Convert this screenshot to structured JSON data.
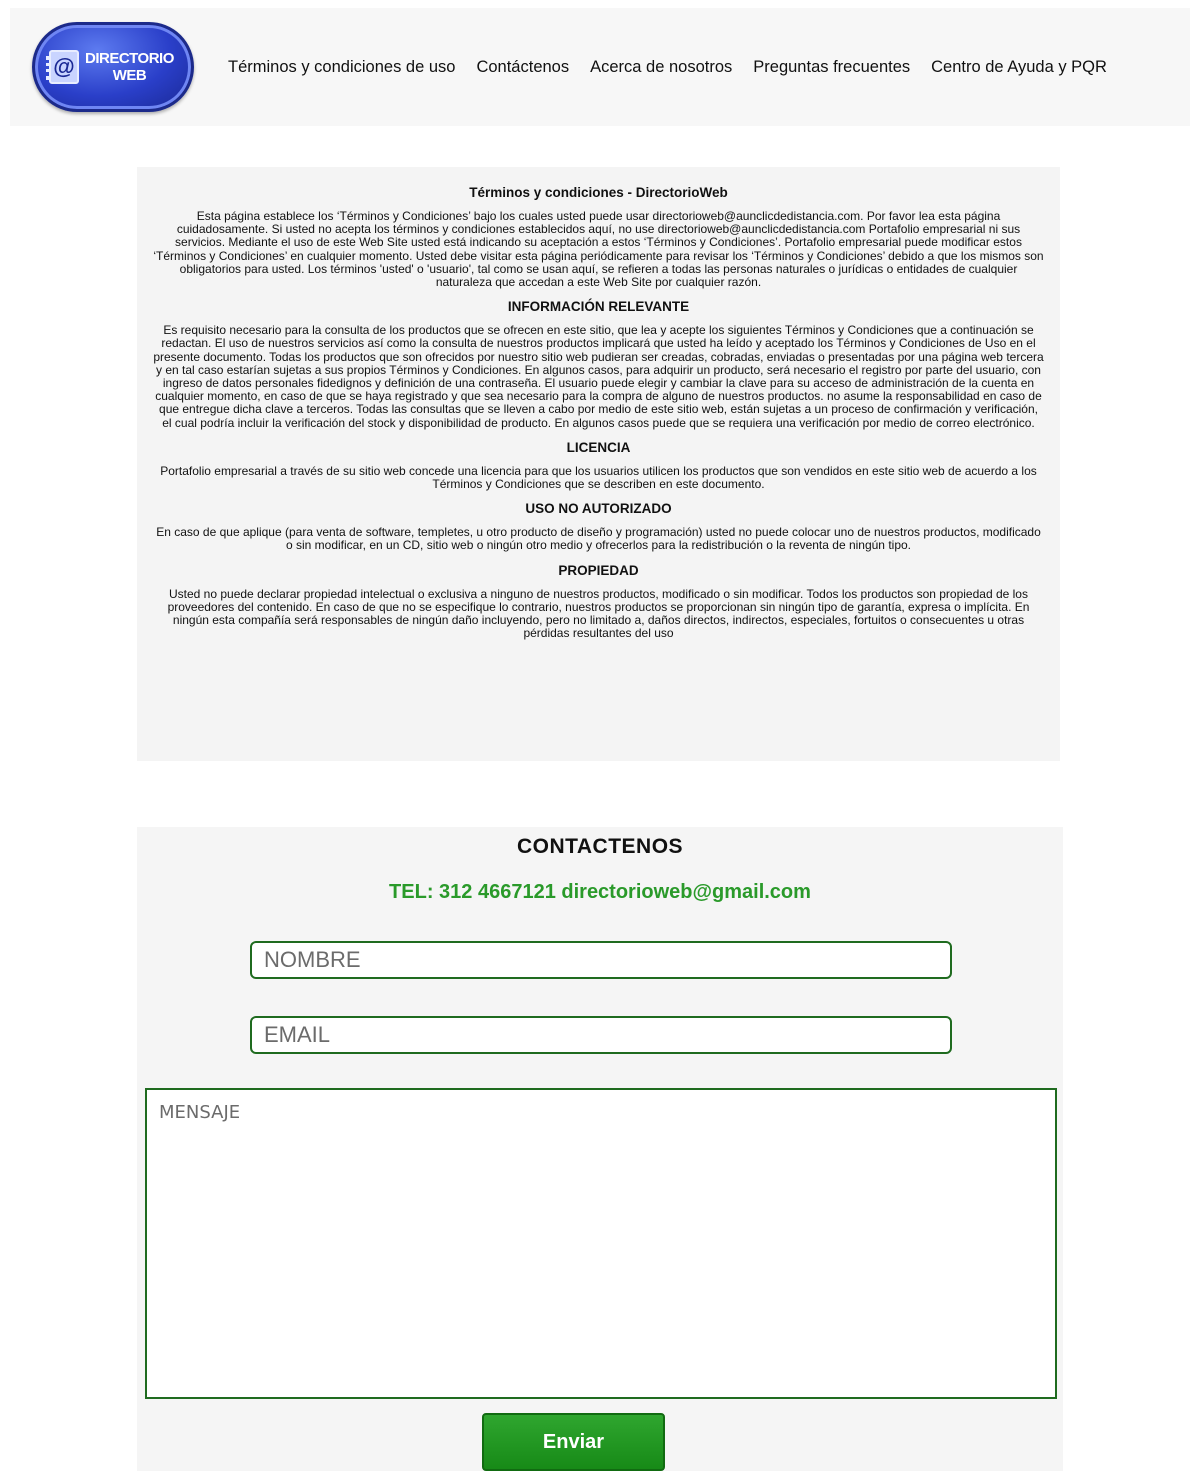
{
  "header": {
    "logo_line1": "DIRECTORIO",
    "logo_line2": "WEB",
    "logo_glyph": "@",
    "nav": [
      "Términos y condiciones de uso",
      "Contáctenos",
      "Acerca de nosotros",
      "Preguntas frecuentes",
      "Centro de Ayuda y PQR"
    ]
  },
  "terms": {
    "title": "Términos y condiciones - DirectorioWeb",
    "intro": "Esta página establece los ‘Términos y Condiciones’ bajo los cuales usted puede usar directorioweb@aunclicdedistancia.com. Por favor lea esta página cuidadosamente. Si usted no acepta los términos y condiciones establecidos aquí, no use directorioweb@aunclicdedistancia.com Portafolio empresarial ni sus servicios. Mediante el uso de este Web Site usted está indicando su aceptación a estos ‘Términos y Condiciones’. Portafolio empresarial puede modificar estos ‘Términos y Condiciones’ en cualquier momento. Usted debe visitar esta página periódicamente para revisar los ‘Términos y Condiciones’ debido a que los mismos son obligatorios para usted. Los términos 'usted' o 'usuario', tal como se usan aquí, se refieren a todas las personas naturales o jurídicas o entidades de cualquier naturaleza que accedan a este Web Site por cualquier razón.",
    "sections": [
      {
        "heading": "INFORMACIÓN RELEVANTE",
        "body": "Es requisito necesario para la consulta de los productos que se ofrecen en este sitio, que lea y acepte los siguientes Términos y Condiciones que a continuación se redactan. El uso de nuestros servicios así como la consulta de nuestros productos implicará que usted ha leído y aceptado los Términos y Condiciones de Uso en el presente documento. Todas los productos que son ofrecidos por nuestro sitio web pudieran ser creadas, cobradas, enviadas o presentadas por una página web tercera y en tal caso estarían sujetas a sus propios Términos y Condiciones. En algunos casos, para adquirir un producto, será necesario el registro por parte del usuario, con ingreso de datos personales fidedignos y definición de una contraseña. El usuario puede elegir y cambiar la clave para su acceso de administración de la cuenta en cualquier momento, en caso de que se haya registrado y que sea necesario para la compra de alguno de nuestros productos. no asume la responsabilidad en caso de que entregue dicha clave a terceros. Todas las consultas que se lleven a cabo por medio de este sitio web, están sujetas a un proceso de confirmación y verificación, el cual podría incluir la verificación del stock y disponibilidad de producto. En algunos casos puede que se requiera una verificación por medio de correo electrónico."
      },
      {
        "heading": "LICENCIA",
        "body": "Portafolio empresarial a través de su sitio web concede una licencia para que los usuarios utilicen los productos que son vendidos en este sitio web de acuerdo a los Términos y Condiciones que se describen en este documento."
      },
      {
        "heading": "USO NO AUTORIZADO",
        "body": "En caso de que aplique (para venta de software, templetes, u otro producto de diseño y programación) usted no puede colocar uno de nuestros productos, modificado o sin modificar, en un CD, sitio web o ningún otro medio y ofrecerlos para la redistribución o la reventa de ningún tipo."
      },
      {
        "heading": "PROPIEDAD",
        "body": "Usted no puede declarar propiedad intelectual o exclusiva a ninguno de nuestros productos, modificado o sin modificar. Todos los productos son propiedad de los proveedores del contenido. En caso de que no se especifique lo contrario, nuestros productos se proporcionan sin ningún tipo de garantía, expresa o implícita. En ningún esta compañía será responsables de ningún daño incluyendo, pero no limitado a, daños directos, indirectos, especiales, fortuitos o consecuentes u otras pérdidas resultantes del uso"
      }
    ]
  },
  "contact": {
    "title": "CONTACTENOS",
    "info": "TEL: 312 4667121 directorioweb@gmail.com",
    "name_placeholder": "NOMBRE",
    "email_placeholder": "EMAIL",
    "message_placeholder": "MENSAJE",
    "send_label": "Enviar"
  },
  "colors": {
    "accent_green": "#2a9a2a",
    "button_green": "#178a17",
    "logo_blue": "#2a3fc9"
  }
}
